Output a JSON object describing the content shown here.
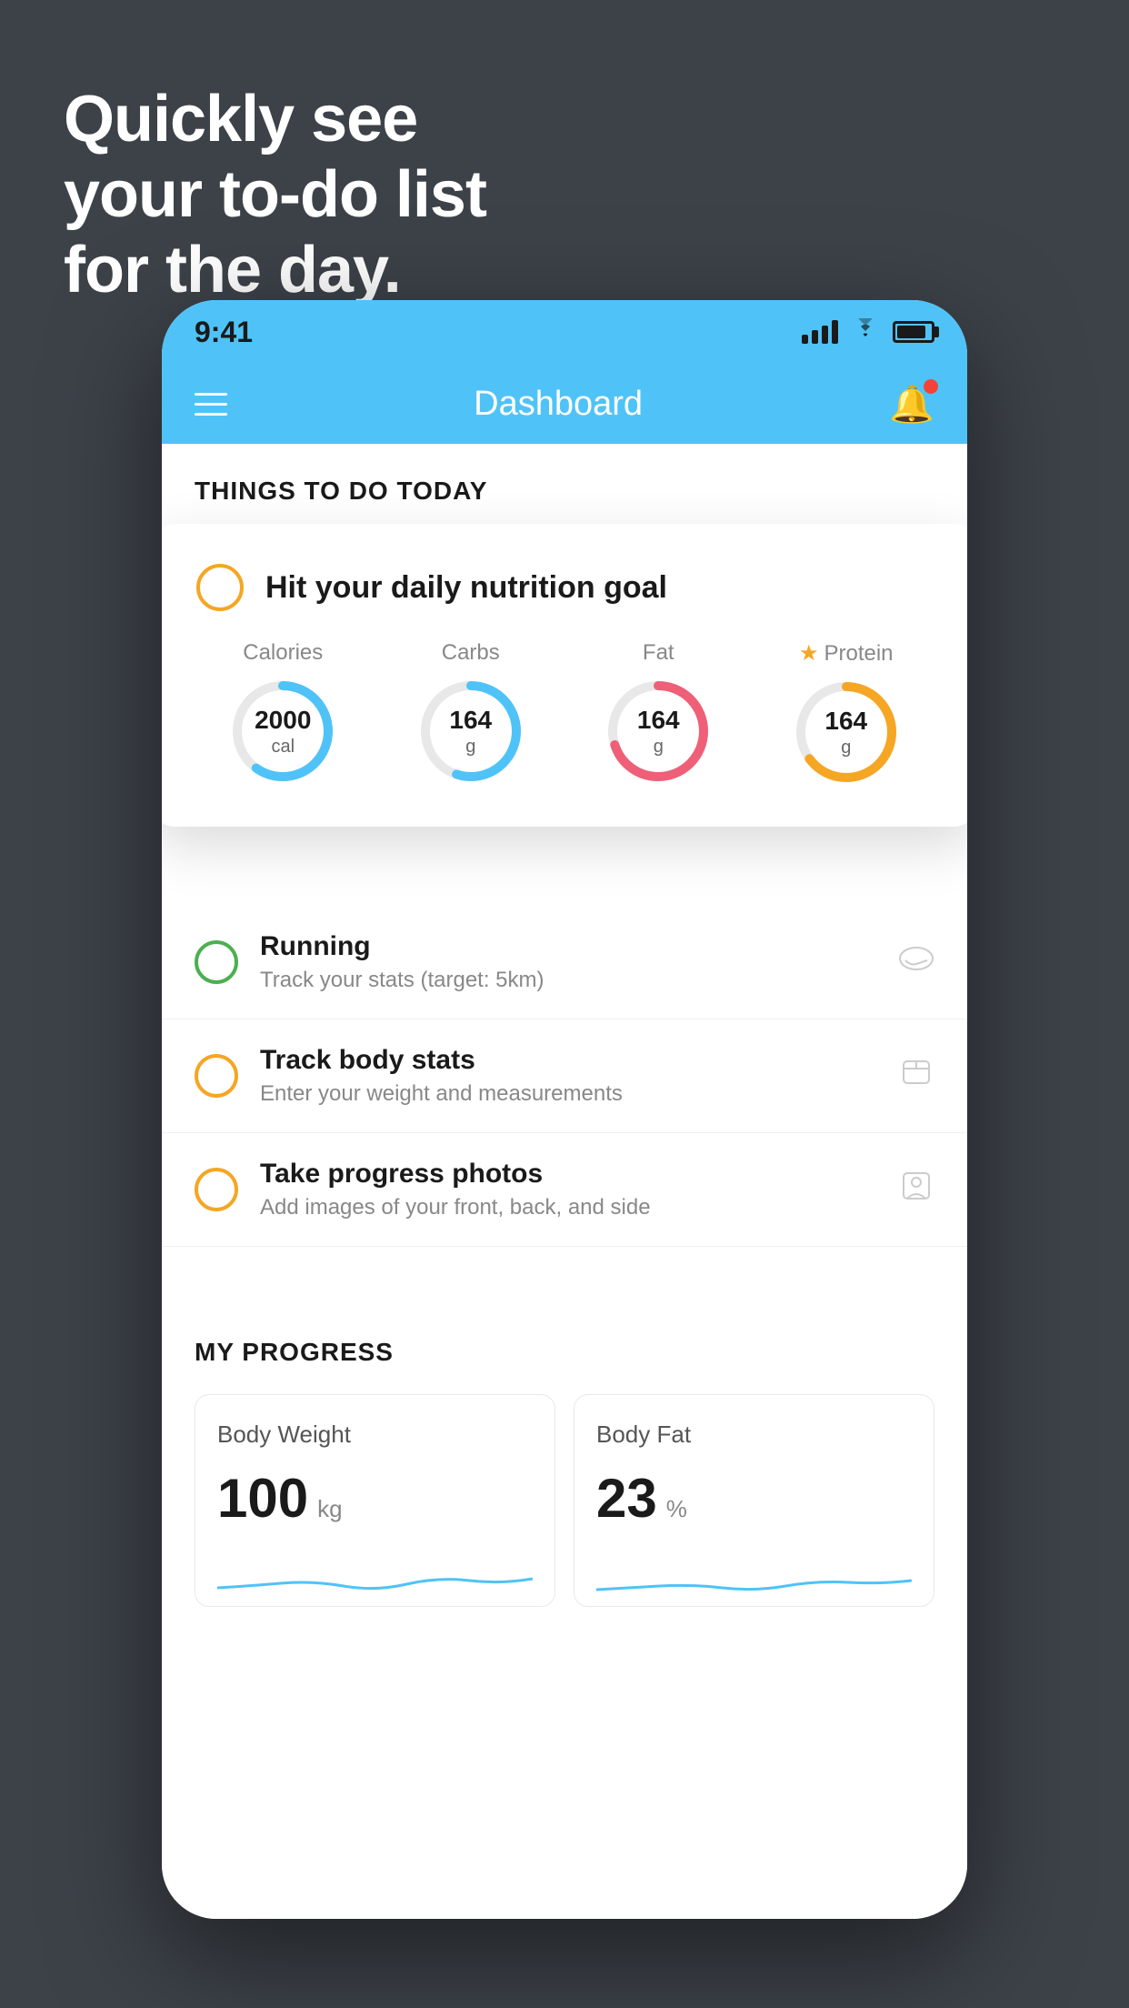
{
  "hero": {
    "line1": "Quickly see",
    "line2": "your to-do list",
    "line3": "for the day."
  },
  "status_bar": {
    "time": "9:41"
  },
  "nav": {
    "title": "Dashboard"
  },
  "things_header": "THINGS TO DO TODAY",
  "floating_card": {
    "title": "Hit your daily nutrition goal",
    "nutrition": [
      {
        "label": "Calories",
        "value": "2000",
        "unit": "cal",
        "color": "#4fc3f7",
        "percent": 60,
        "starred": false
      },
      {
        "label": "Carbs",
        "value": "164",
        "unit": "g",
        "color": "#4fc3f7",
        "percent": 55,
        "starred": false
      },
      {
        "label": "Fat",
        "value": "164",
        "unit": "g",
        "color": "#ef5f78",
        "percent": 70,
        "starred": false
      },
      {
        "label": "Protein",
        "value": "164",
        "unit": "g",
        "color": "#f5a623",
        "percent": 65,
        "starred": true
      }
    ]
  },
  "todo_list": [
    {
      "title": "Running",
      "subtitle": "Track your stats (target: 5km)",
      "circle_color": "green",
      "icon": "👟"
    },
    {
      "title": "Track body stats",
      "subtitle": "Enter your weight and measurements",
      "circle_color": "yellow",
      "icon": "⊡"
    },
    {
      "title": "Take progress photos",
      "subtitle": "Add images of your front, back, and side",
      "circle_color": "yellow2",
      "icon": "👤"
    }
  ],
  "progress": {
    "header": "MY PROGRESS",
    "cards": [
      {
        "title": "Body Weight",
        "value": "100",
        "unit": "kg"
      },
      {
        "title": "Body Fat",
        "value": "23",
        "unit": "%"
      }
    ]
  }
}
